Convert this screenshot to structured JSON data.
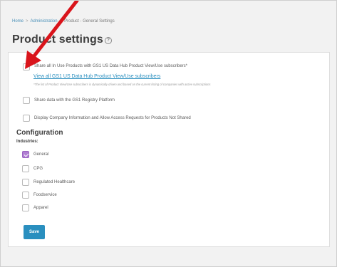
{
  "breadcrumb": {
    "home": "Home",
    "admin": "Administration",
    "current": "Product - General Settings"
  },
  "page": {
    "title": "Product settings",
    "help_glyph": "?"
  },
  "options": [
    {
      "label": "Share all In Use Products with GS1 US Data Hub Product View/Use subscribers*",
      "checked": false
    },
    {
      "label": "Share data with the GS1 Registry Platform",
      "checked": false
    },
    {
      "label": "Display Company Information and Allow Access Requests for Products Not Shared",
      "checked": false
    }
  ],
  "subscribers_link": "View all GS1 US Data Hub Product View/Use subscribers",
  "subscribers_note": "*The list of Product View/Use subscribers is dynamically driven and based on the current listing of companies with active subscriptions",
  "configuration": {
    "title": "Configuration",
    "industries_label": "Industries:",
    "industries": [
      {
        "label": "General",
        "checked": true
      },
      {
        "label": "CPG",
        "checked": false
      },
      {
        "label": "Regulated Healthcare",
        "checked": false
      },
      {
        "label": "Foodservice",
        "checked": false
      },
      {
        "label": "Apparel",
        "checked": false
      }
    ]
  },
  "actions": {
    "save_label": "Save"
  },
  "colors": {
    "accent": "#2a8fbf",
    "checked": "#b07fd2",
    "arrow": "#d9141b"
  }
}
